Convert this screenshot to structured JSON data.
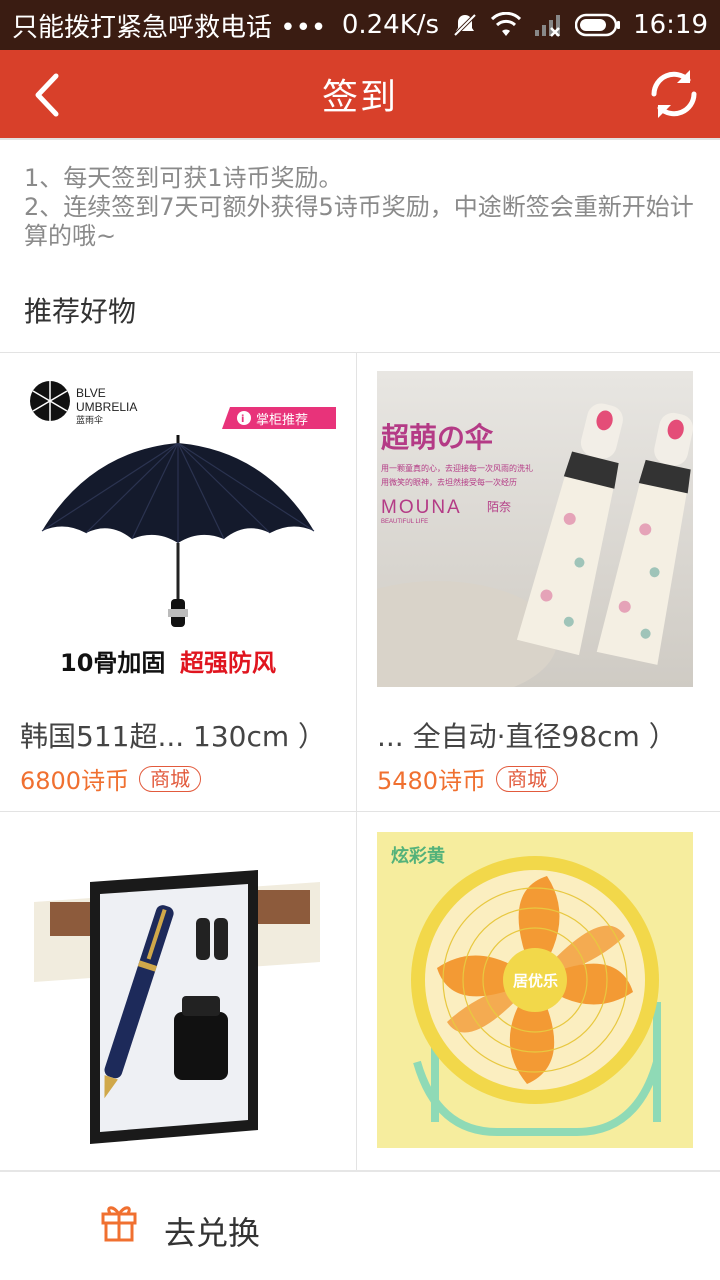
{
  "status_bar": {
    "carrier": "只能拨打紧急呼救电话 •••",
    "speed": "0.24K/s",
    "time": "16:19"
  },
  "header": {
    "title": "签到",
    "back_icon": "chevron-left-icon",
    "refresh_icon": "refresh-icon"
  },
  "rules": {
    "line1": "1、每天签到可获1诗币奖励。",
    "line2": "2、连续签到7天可额外获得5诗币奖励，中途断签会重新开始计算的哦~"
  },
  "section": {
    "title": "推荐好物"
  },
  "products": [
    {
      "name": "韩国511超... 130cm ）",
      "price": "6800诗币",
      "tag": "商城",
      "image": {
        "brand_line1": "BLVE",
        "brand_line2": "UMBRELIA",
        "brand_cn": "蓝雨伞",
        "badge": "掌柜推荐",
        "caption_black": "10骨加固",
        "caption_red": "超强防风"
      }
    },
    {
      "name": "... 全自动·直径98cm ）",
      "price": "5480诗币",
      "tag": "商城",
      "image": {
        "headline": "超萌の伞",
        "sub1": "用一颗童真的心，去迎接每一次风雨的洗礼",
        "sub2": "用微笑的眼神，去坦然接受每一次经历",
        "brand": "MOUNA",
        "brand_cn": "陌奈",
        "brand_sub": "BEAUTIFUL LIFE"
      }
    },
    {
      "name": "",
      "price": "",
      "tag": "",
      "image": {}
    },
    {
      "name": "",
      "price": "",
      "tag": "",
      "image": {
        "label": "炫彩黄",
        "hub_text": "居优乐"
      }
    }
  ],
  "bottom": {
    "exchange_label": "去兑换",
    "exchange_icon": "gift-icon"
  },
  "colors": {
    "status_bar": "#3a1c12",
    "header": "#d8402a",
    "price": "#f07030",
    "tag": "#e25a3c"
  }
}
